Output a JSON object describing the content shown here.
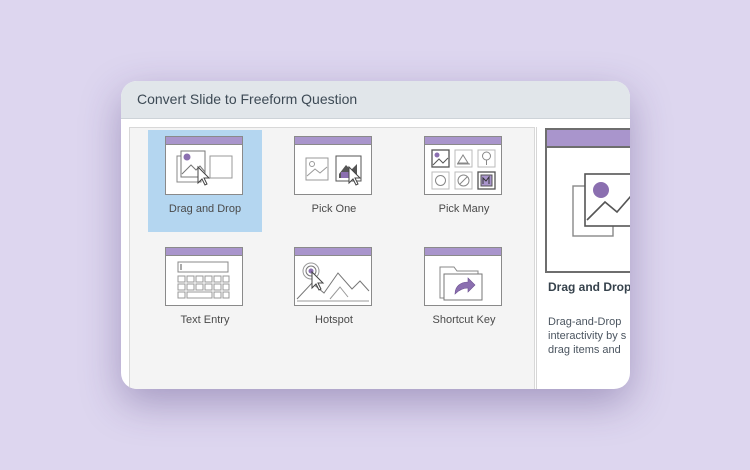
{
  "dialog": {
    "title": "Convert Slide to Freeform Question"
  },
  "colors": {
    "background": "#ddd6ef",
    "accent": "#a995cc",
    "selected": "#b4d6f0",
    "titlebar": "#e1e6ea"
  },
  "options": [
    {
      "label": "Drag and Drop",
      "icon": "drag-and-drop-icon",
      "selected": true
    },
    {
      "label": "Pick One",
      "icon": "pick-one-icon",
      "selected": false
    },
    {
      "label": "Pick Many",
      "icon": "pick-many-icon",
      "selected": false
    },
    {
      "label": "Text Entry",
      "icon": "text-entry-icon",
      "selected": false
    },
    {
      "label": "Hotspot",
      "icon": "hotspot-icon",
      "selected": false
    },
    {
      "label": "Shortcut Key",
      "icon": "shortcut-key-icon",
      "selected": false
    }
  ],
  "preview": {
    "title": "Drag and Drop",
    "description_lines": [
      "Drag-and-Drop",
      "interactivity by s",
      "drag items and"
    ]
  }
}
